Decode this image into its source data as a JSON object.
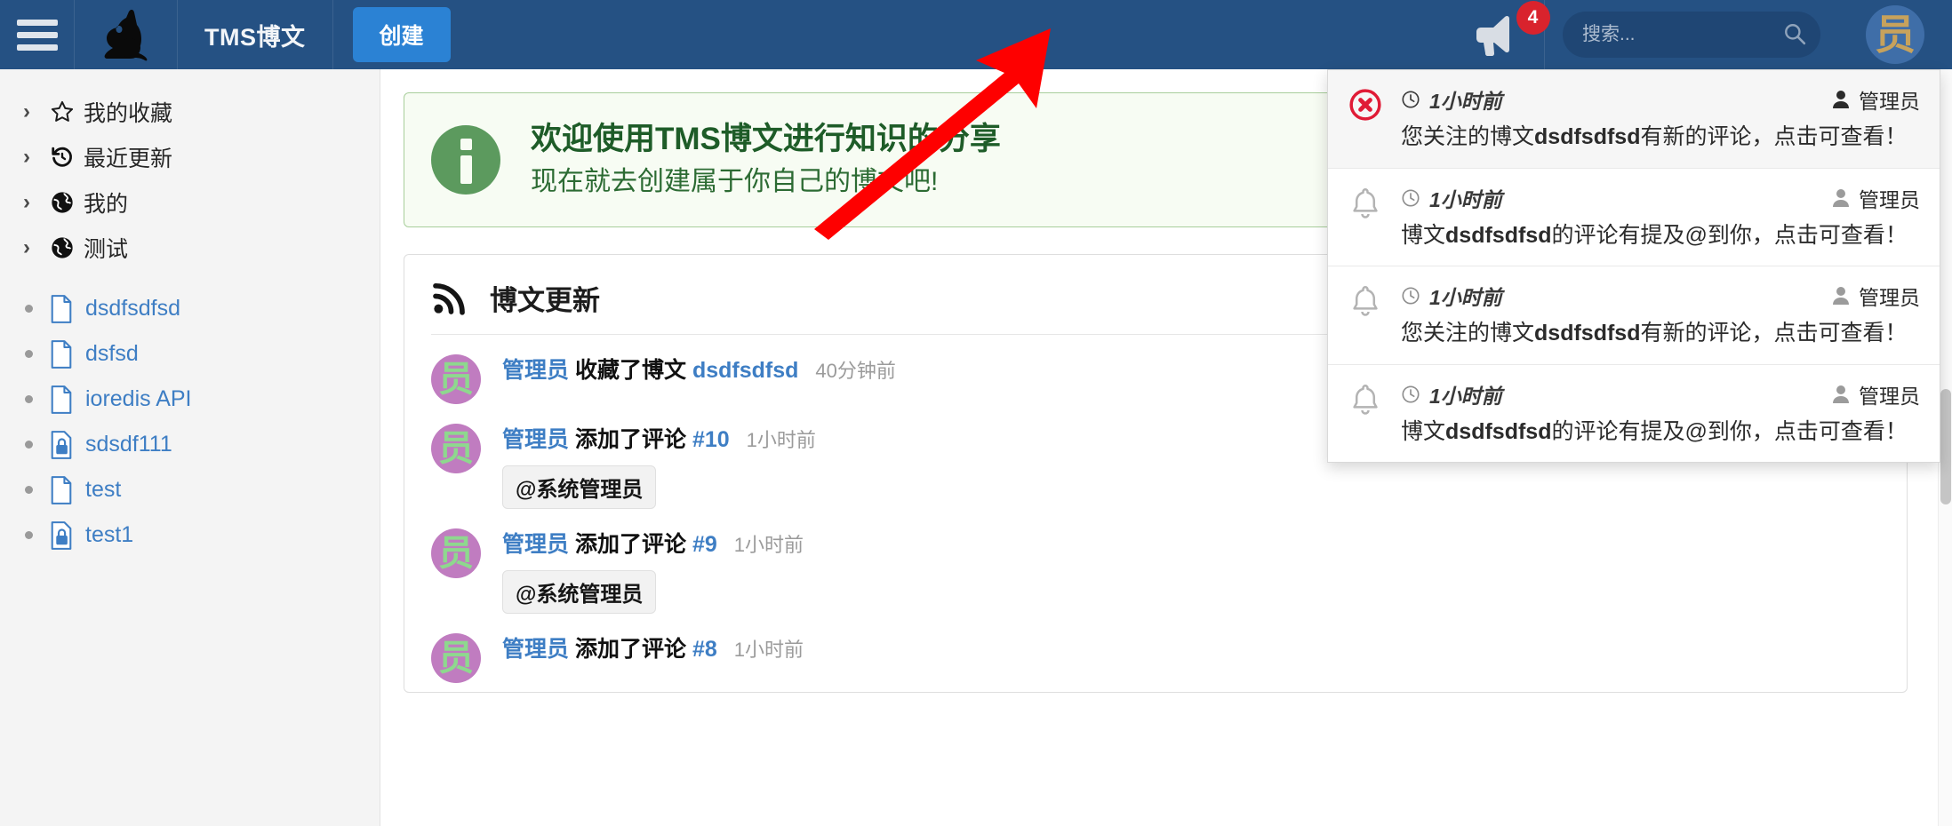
{
  "header": {
    "menu_icon": "hamburger-icon",
    "logo_icon": "rabbit-logo-icon",
    "brand": "TMS博文",
    "create_label": "创建",
    "notify_icon": "megaphone-icon",
    "notify_badge": "4",
    "search_placeholder": "搜索...",
    "search_value": "",
    "search_icon": "search-icon",
    "avatar_text": "员",
    "bg_color": "#255183",
    "accent_color": "#2b82d4"
  },
  "sidebar": {
    "tree": [
      {
        "label": "我的收藏",
        "icon": "star-icon",
        "chevron": "chevron-right-icon"
      },
      {
        "label": "最近更新",
        "icon": "history-icon",
        "chevron": "chevron-right-icon"
      },
      {
        "label": "我的",
        "icon": "globe-icon",
        "chevron": "chevron-right-icon"
      },
      {
        "label": "测试",
        "icon": "globe-icon",
        "chevron": "chevron-right-icon"
      }
    ],
    "docs": [
      {
        "label": "dsdfsdfsd",
        "icon": "file-icon"
      },
      {
        "label": "dsfsd",
        "icon": "file-icon"
      },
      {
        "label": "ioredis API",
        "icon": "file-icon"
      },
      {
        "label": "sdsdf111",
        "icon": "file-lock-icon"
      },
      {
        "label": "test",
        "icon": "file-icon"
      },
      {
        "label": "test1",
        "icon": "file-lock-icon"
      }
    ],
    "link_color": "#3e7ec4"
  },
  "main": {
    "welcome": {
      "icon": "info-circle-icon",
      "title": "欢迎使用TMS博文进行知识的分享",
      "subtitle": "现在就去创建属于你自己的博文吧!",
      "border_color": "#a8ce9b",
      "bg_color": "#f7fcf3",
      "text_color": "#1e5c28"
    },
    "feed": {
      "icon": "rss-icon",
      "title": "博文更新",
      "items": [
        {
          "avatar": "员",
          "who": "管理员",
          "verb": "收藏了博文",
          "target": "dsdfsdfsd",
          "when": "40分钟前",
          "mention": ""
        },
        {
          "avatar": "员",
          "who": "管理员",
          "verb": "添加了评论",
          "target": "#10",
          "when": "1小时前",
          "mention": "@系统管理员"
        },
        {
          "avatar": "员",
          "who": "管理员",
          "verb": "添加了评论",
          "target": "#9",
          "when": "1小时前",
          "mention": "@系统管理员"
        },
        {
          "avatar": "员",
          "who": "管理员",
          "verb": "添加了评论",
          "target": "#8",
          "when": "1小时前",
          "mention": ""
        }
      ]
    }
  },
  "notifications": {
    "items": [
      {
        "icon": "delete-circle-icon",
        "time": "1小时前",
        "user": "管理员",
        "text_before": "您关注的博文",
        "text_bold": "dsdfsdfsd",
        "text_after": "有新的评论，点击可查看！",
        "unread": true
      },
      {
        "icon": "bell-icon",
        "time": "1小时前",
        "user": "管理员",
        "text_before": "博文",
        "text_bold": "dsdfsdfsd",
        "text_after": "的评论有提及@到你，点击可查看！",
        "unread": false
      },
      {
        "icon": "bell-icon",
        "time": "1小时前",
        "user": "管理员",
        "text_before": "您关注的博文",
        "text_bold": "dsdfsdfsd",
        "text_after": "有新的评论，点击可查看！",
        "unread": false
      },
      {
        "icon": "bell-icon",
        "time": "1小时前",
        "user": "管理员",
        "text_before": "博文",
        "text_bold": "dsdfsdfsd",
        "text_after": "的评论有提及@到你，点击可查看！",
        "unread": false
      }
    ],
    "clock_icon": "clock-icon",
    "user_icon": "user-icon"
  },
  "annotation": {
    "arrow_color": "#fe0000",
    "shape": "arrow-up-right"
  }
}
